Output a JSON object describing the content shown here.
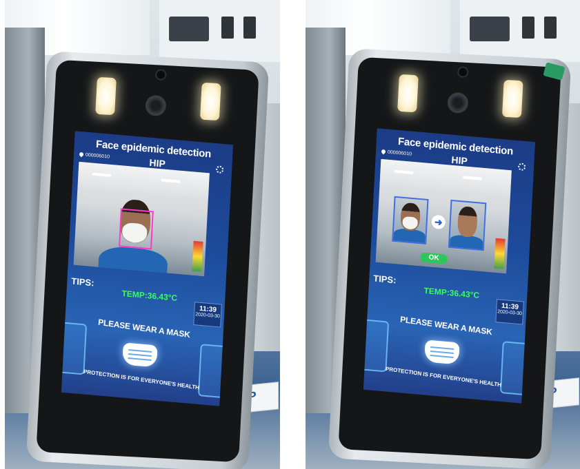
{
  "photos": [
    {
      "id_label": "left-photo",
      "screen": {
        "title": "Face epidemic detection",
        "device_id": "000006010",
        "brand": "HIP",
        "tips_label": "TIPS:",
        "temperature": "TEMP:36.43°C",
        "time": "11:39",
        "date": "2020-03-30",
        "banner": "PLEASE WEAR A MASK",
        "footer": "PROTECTION IS FOR EVERYONE'S HEALTH"
      }
    },
    {
      "id_label": "right-photo",
      "screen": {
        "title": "Face epidemic detection",
        "device_id": "000006010",
        "brand": "HIP",
        "tips_label": "TIPS:",
        "temperature": "TEMP:36.43°C",
        "time": "11:39",
        "date": "2020-03-30",
        "banner": "PLEASE WEAR A MASK",
        "footer": "PROTECTION IS FOR EVERYONE'S HEALTH",
        "match_status": "OK"
      }
    }
  ],
  "background_card_logo": "HIP",
  "colors": {
    "screen_blue": "#1d4b9b",
    "temp_green": "#38ff5c",
    "face_box": "#ff39c8",
    "ok_green": "#2ec65c",
    "device_frame": "#c7ced3"
  },
  "icons": [
    "location-pin-icon",
    "settings-gear-icon",
    "arrow-right-icon",
    "face-mask-icon"
  ]
}
